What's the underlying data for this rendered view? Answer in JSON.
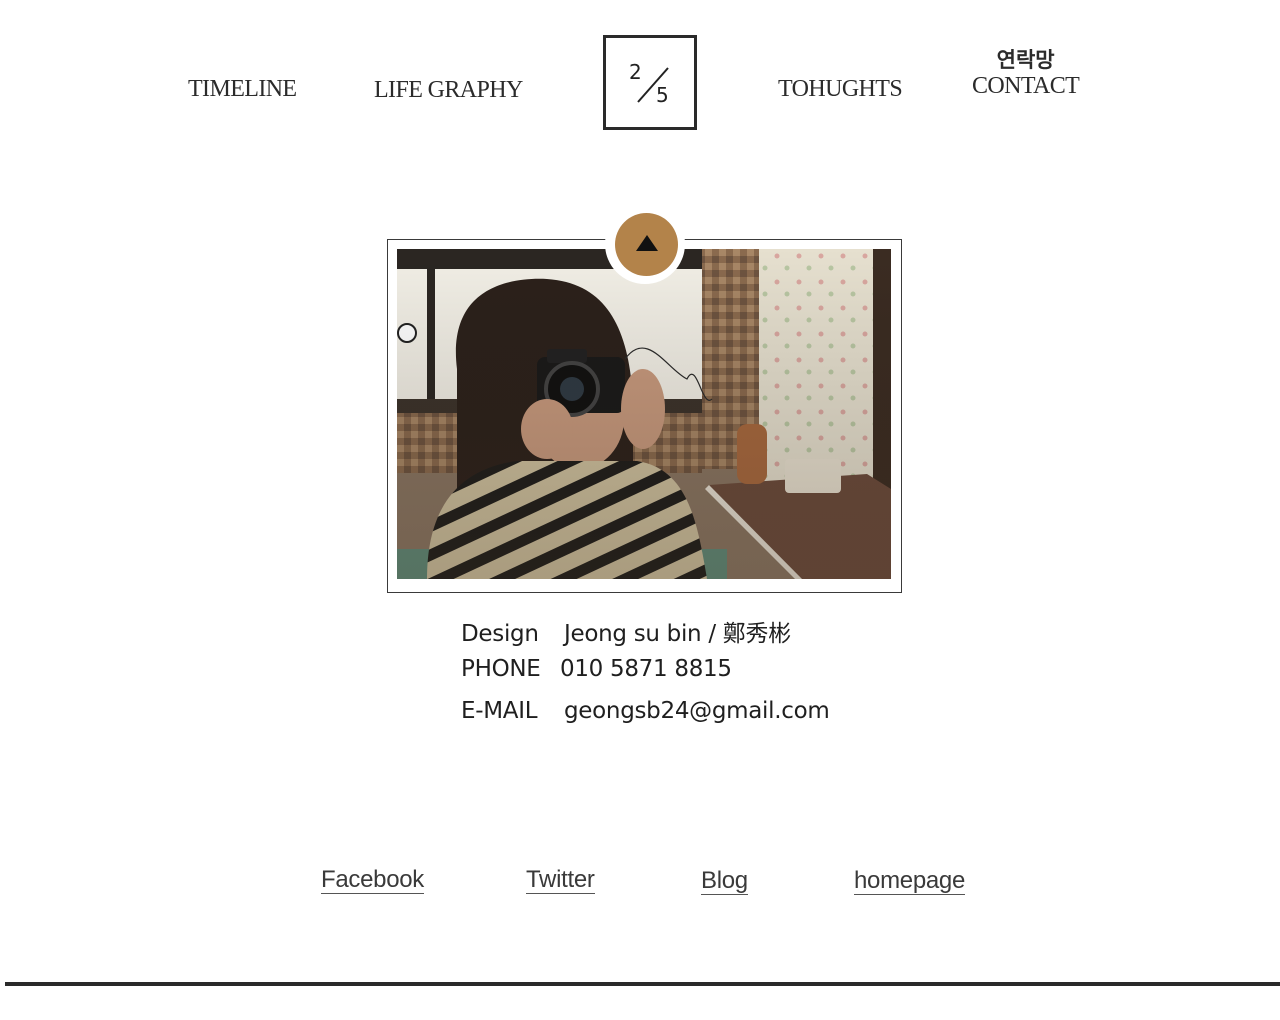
{
  "nav": {
    "timeline": "TIMELINE",
    "life_graphy": "LIFE GRAPHY",
    "thoughts": "TOHUGHTS",
    "contact_korean": "연락망",
    "contact": "CONTACT"
  },
  "pagination": {
    "current": "2",
    "total": "5"
  },
  "photo": {
    "accent_color": "#b3834a"
  },
  "contact_info": {
    "design_label": "Design",
    "design_value": "Jeong su bin / 鄭秀彬",
    "phone_label": "PHONE",
    "phone_value": "010 5871 8815",
    "email_label": "E-MAIL",
    "email_value": "geongsb24@gmail.com"
  },
  "footer_links": {
    "facebook": "Facebook",
    "twitter": "Twitter",
    "blog": "Blog",
    "homepage": "homepage"
  }
}
